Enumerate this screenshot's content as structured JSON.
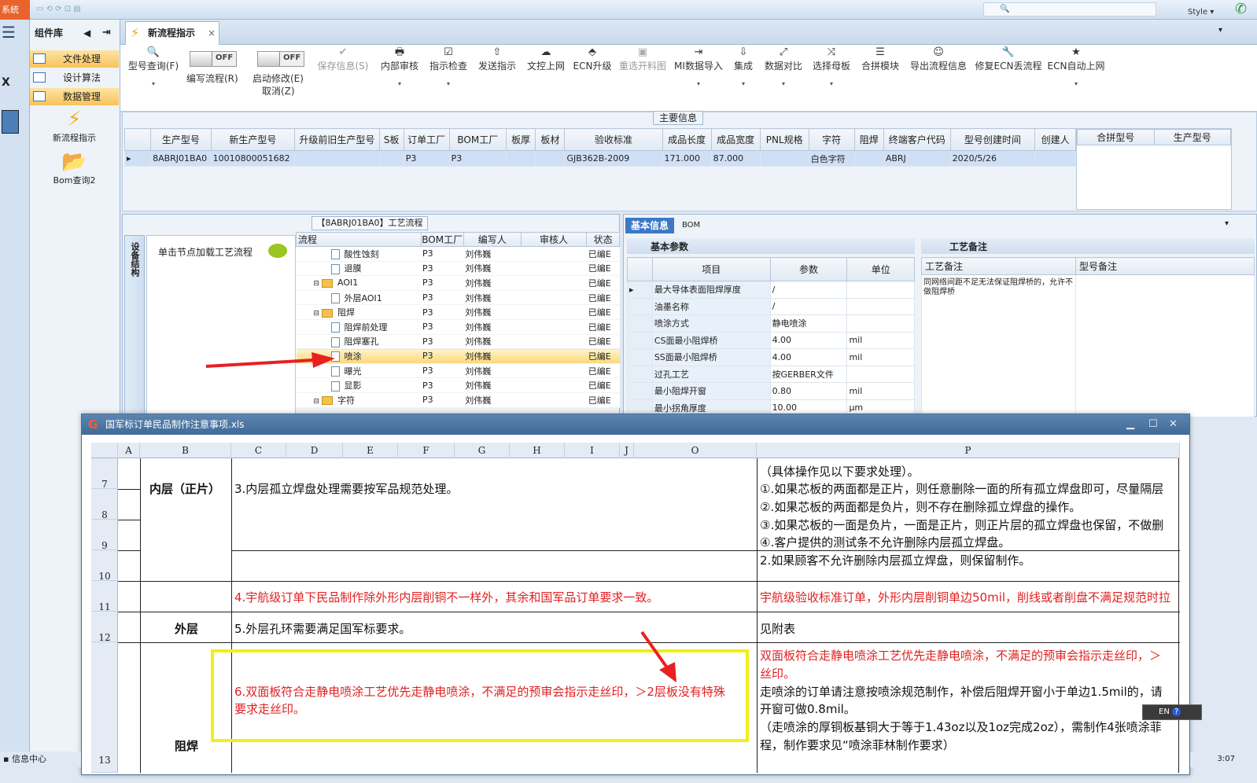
{
  "titlebar": {
    "app_label": "系統",
    "style_label": "Style"
  },
  "strip": {
    "menu_icon": "hamburger-icon"
  },
  "library": {
    "title": "组件库",
    "items": [
      {
        "label": "文件处理",
        "active": true
      },
      {
        "label": "设计算法",
        "active": false
      },
      {
        "label": "数据管理",
        "active": true
      }
    ],
    "big": [
      {
        "label": "新流程指示",
        "icon": "lightning-icon"
      },
      {
        "label": "Bom查询2",
        "icon": "folder-icon"
      }
    ]
  },
  "tab": {
    "label": "新流程指示",
    "close": "×"
  },
  "ribbon": {
    "buttons": [
      {
        "label": "型号查询(F)",
        "icon": "🔍",
        "disabled": false,
        "dropdown": true
      },
      {
        "label": "编写流程(R)",
        "toggle": "OFF"
      },
      {
        "label": "启动修改(E)",
        "sub": "取消(Z)",
        "toggle": "OFF"
      },
      {
        "label": "保存信息(S)",
        "icon": "✔",
        "disabled": true
      },
      {
        "label": "内部审核",
        "icon": "🖶",
        "dropdown": true
      },
      {
        "label": "指示检查",
        "icon": "☑",
        "dropdown": true
      },
      {
        "label": "发送指示",
        "icon": "⇧"
      },
      {
        "label": "文控上网",
        "icon": "☁"
      },
      {
        "label": "ECN升级",
        "icon": "⬘"
      },
      {
        "label": "重选开料图",
        "icon": "▣",
        "disabled": true
      },
      {
        "label": "MI数据导入",
        "icon": "⇥",
        "dropdown": true
      },
      {
        "label": "集成",
        "icon": "⇩",
        "dropdown": true
      },
      {
        "label": "数据对比",
        "icon": "⤢",
        "dropdown": true
      },
      {
        "label": "选择母板",
        "icon": "⤨",
        "dropdown": true
      },
      {
        "label": "合拼模块",
        "icon": "☰"
      },
      {
        "label": "导出流程信息",
        "icon": "☺"
      },
      {
        "label": "修复ECN丢流程",
        "icon": "🔧"
      },
      {
        "label": "ECN自动上网",
        "icon": "★",
        "dropdown": true
      }
    ]
  },
  "main_info": {
    "caption": "主要信息",
    "columns": [
      "生产型号",
      "新生产型号",
      "升级前旧生产型号",
      "S板",
      "订单工厂",
      "BOM工厂",
      "板厚",
      "板材",
      "验收标准",
      "成品长度",
      "成品宽度",
      "PNL规格",
      "字符",
      "阻焊",
      "终端客户代码",
      "型号创建时间",
      "创建人"
    ],
    "rows": [
      [
        "8ABRJ01BA0",
        "10010800051682",
        "",
        "",
        "P3",
        "P3",
        "",
        "",
        "GJB362B-2009",
        "171.000",
        "87.000",
        "",
        "白色字符",
        "",
        "ABRJ",
        "2020/5/26",
        ""
      ]
    ],
    "merge_columns": [
      "合拼型号",
      "生产型号"
    ]
  },
  "flow": {
    "caption": "【8ABRJ01BA0】工艺流程",
    "vtab": "设备结构",
    "node_hint": "单击节点加载工艺流程",
    "columns": [
      "流程",
      "BOM工厂",
      "编写人",
      "审核人",
      "状态"
    ],
    "rows": [
      {
        "name": "酸性蚀刻",
        "folder": false,
        "indent": 2,
        "bom": "P3",
        "writer": "刘伟巍",
        "reviewer": "",
        "status": "已编E",
        "hl": false
      },
      {
        "name": "退膜",
        "folder": false,
        "indent": 2,
        "bom": "P3",
        "writer": "刘伟巍",
        "reviewer": "",
        "status": "已编E",
        "hl": false
      },
      {
        "name": "AOI1",
        "folder": true,
        "indent": 1,
        "bom": "P3",
        "writer": "刘伟巍",
        "reviewer": "",
        "status": "已编E",
        "hl": false
      },
      {
        "name": "外层AOI1",
        "folder": false,
        "indent": 2,
        "bom": "P3",
        "writer": "刘伟巍",
        "reviewer": "",
        "status": "已编E",
        "hl": false
      },
      {
        "name": "阻焊",
        "folder": true,
        "indent": 1,
        "bom": "P3",
        "writer": "刘伟巍",
        "reviewer": "",
        "status": "已编E",
        "hl": false
      },
      {
        "name": "阻焊前处理",
        "folder": false,
        "indent": 2,
        "bom": "P3",
        "writer": "刘伟巍",
        "reviewer": "",
        "status": "已编E",
        "hl": false
      },
      {
        "name": "阻焊塞孔",
        "folder": false,
        "indent": 2,
        "bom": "P3",
        "writer": "刘伟巍",
        "reviewer": "",
        "status": "已编E",
        "hl": false
      },
      {
        "name": "喷涂",
        "folder": false,
        "indent": 2,
        "bom": "P3",
        "writer": "刘伟巍",
        "reviewer": "",
        "status": "已编E",
        "hl": true
      },
      {
        "name": "曝光",
        "folder": false,
        "indent": 2,
        "bom": "P3",
        "writer": "刘伟巍",
        "reviewer": "",
        "status": "已编E",
        "hl": false
      },
      {
        "name": "显影",
        "folder": false,
        "indent": 2,
        "bom": "P3",
        "writer": "刘伟巍",
        "reviewer": "",
        "status": "已编E",
        "hl": false
      },
      {
        "name": "字符",
        "folder": true,
        "indent": 1,
        "bom": "P3",
        "writer": "刘伟巍",
        "reviewer": "",
        "status": "已编E",
        "hl": false
      }
    ]
  },
  "base": {
    "tab1": "基本信息",
    "tab2": "BOM",
    "param_title": "基本参数",
    "param_columns": [
      "项目",
      "参数",
      "单位"
    ],
    "params": [
      [
        "最大导体表面阻焊厚度",
        "/",
        ""
      ],
      [
        "油墨名称",
        "/",
        ""
      ],
      [
        "喷涂方式",
        "静电喷涂",
        ""
      ],
      [
        "CS面最小阻焊桥",
        "4.00",
        "mil"
      ],
      [
        "SS面最小阻焊桥",
        "4.00",
        "mil"
      ],
      [
        "过孔工艺",
        "按GERBER文件",
        ""
      ],
      [
        "最小阻焊开窗",
        "0.80",
        "mil"
      ],
      [
        "最小拐角厚度",
        "10.00",
        "μm"
      ]
    ],
    "note_title": "工艺备注",
    "note_columns": [
      "工艺备注",
      "型号备注"
    ],
    "note_text": "同网络间距不足无法保证阻焊桥的，允许不做阻焊桥"
  },
  "excel": {
    "title": "国军标订单民品制作注意事项.xls",
    "columns": [
      "A",
      "B",
      "C",
      "D",
      "E",
      "F",
      "G",
      "H",
      "I",
      "J",
      "O",
      "P"
    ],
    "rows": [
      "7",
      "8",
      "9",
      "10",
      "11",
      "12",
      "13"
    ],
    "b_inner": "内层（正片）",
    "b_outer": "外层",
    "b_solder": "阻焊",
    "c7": "3.内层孤立焊盘处理需要按军品规范处理。",
    "c11": "4.宇航级订单下民品制作除外形内层削铜不一样外，其余和国军品订单要求一致。",
    "c12": "5.外层孔环需要满足国军标要求。",
    "c13a": "6.双面板符合走静电喷涂工艺优先走静电喷涂，不满足的预审会指示走丝印，＞2层板没有特殊",
    "c13b": "要求走丝印。",
    "p7": "（具体操作见以下要求处理）。",
    "p8a": "①.如果芯板的两面都是正片，则任意删除一面的所有孤立焊盘即可，尽量隔层",
    "p8b": "②.如果芯板的两面都是负片，则不存在删除孤立焊盘的操作。",
    "p9a": "③.如果芯板的一面是负片，一面是正片，则正片层的孤立焊盘也保留，不做删",
    "p9b": "④.客户提供的测试条不允许删除内层孤立焊盘。",
    "p10": "2.如果顾客不允许删除内层孤立焊盘，则保留制作。",
    "p11": "宇航级验收标准订单，外形内层削铜单边50mil，削线或者削盘不满足规范时拉",
    "p12": "见附表",
    "p13a": "双面板符合走静电喷涂工艺优先走静电喷涂，不满足的预审会指示走丝印，＞",
    "p13b": "丝印。",
    "p13c": "走喷涂的订单请注意按喷涂规范制作，补偿后阻焊开窗小于单边1.5mil的，请",
    "p13d": "开窗可做0.8mil。",
    "p13e": "（走喷涂的厚铜板基铜大于等于1.43oz以及1oz完成2oz），需制作4张喷涂菲",
    "p13f": "程，制作要求见“喷涂菲林制作要求）"
  },
  "status": {
    "left": "信息中心",
    "right": "3:07",
    "lang": "EN"
  }
}
